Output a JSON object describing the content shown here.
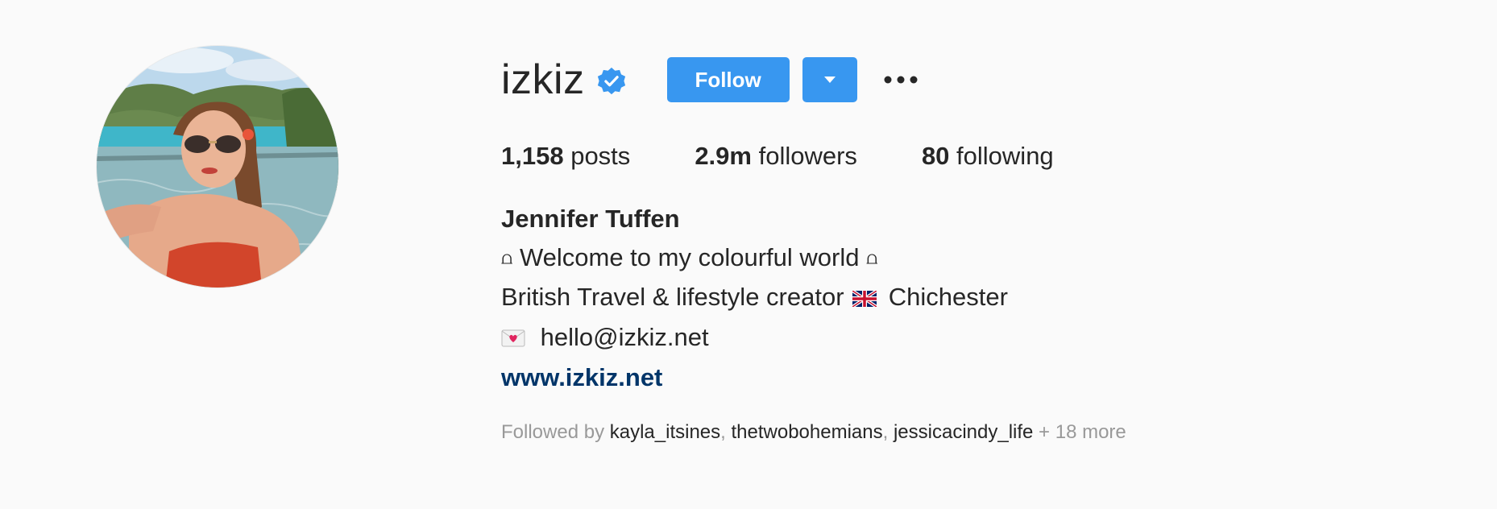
{
  "profile": {
    "username": "izkiz",
    "verified": true,
    "follow_label": "Follow",
    "stats": {
      "posts_count": "1,158",
      "posts_label": "posts",
      "followers_count": "2.9m",
      "followers_label": "followers",
      "following_count": "80",
      "following_label": "following"
    },
    "full_name": "Jennifer Tuffen",
    "bio": {
      "line1_glyph_left": "⩍",
      "line1_text": "Welcome to my colourful world",
      "line1_glyph_right": "⩍",
      "line2_text_before_flag": "British Travel & lifestyle creator",
      "line2_text_after_flag": "Chichester",
      "line3_email": "hello@izkiz.net",
      "website": "www.izkiz.net"
    },
    "followed_by": {
      "prefix": "Followed by",
      "users": [
        "kayla_itsines",
        "thetwobohemians",
        "jessicacindy_life"
      ],
      "more": "+ 18 more"
    }
  },
  "colors": {
    "background": "#fafafa",
    "primary_button": "#3897f0",
    "verified_badge": "#3897f0",
    "link": "#003569",
    "secondary_text": "#999999",
    "text": "#262626"
  },
  "icons": {
    "verified": "verified-badge-icon",
    "dropdown": "caret-down-icon",
    "more": "more-options-icon",
    "flag": "uk-flag-icon",
    "envelope": "love-letter-icon"
  }
}
